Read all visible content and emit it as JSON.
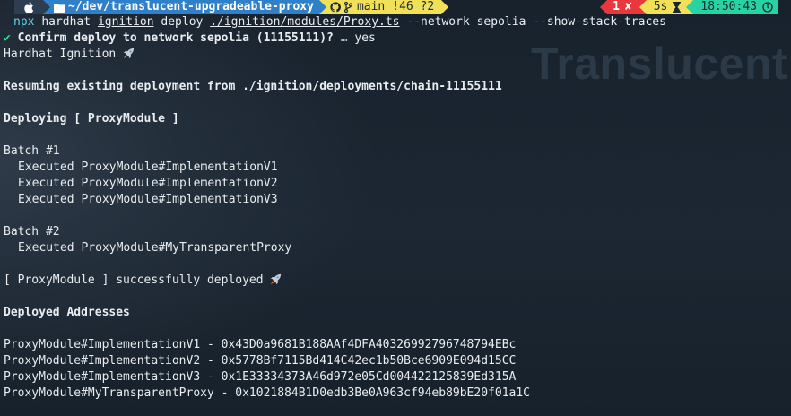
{
  "prompt": {
    "os_icon": "apple-icon",
    "folder_icon": "folder-icon",
    "path": "~/dev/translucent-upgradeable-proxy",
    "git_icon": "git-branch-icon",
    "branch": "main",
    "git_status": "!46 ?2",
    "exit_code": "1",
    "exit_mark": "✘",
    "duration": "5s",
    "duration_icon": "hourglass-icon",
    "time": "18:50:43",
    "clock_icon": "clock-icon",
    "colors": {
      "os": "#2c3e50",
      "dir": "#2f80c8",
      "git": "#f1e05a",
      "err": "#e8383d",
      "dur": "#f1e05a",
      "time": "#27d3a2"
    }
  },
  "command": {
    "npx": "npx",
    "hardhat": "hardhat",
    "ignition": "ignition",
    "deploy": "deploy",
    "file": "./ignition/modules/Proxy.ts",
    "args": "--network sepolia --show-stack-traces"
  },
  "confirm": {
    "check": "✔",
    "question": "Confirm deploy to network sepolia (11155111)?",
    "ellipsis": "…",
    "answer": "yes"
  },
  "output": {
    "ignition_title": "Hardhat Ignition",
    "resuming": "Resuming existing deployment from ./ignition/deployments/chain-11155111",
    "deploying": "Deploying [ ProxyModule ]",
    "batch1": "Batch #1",
    "batch1_items": [
      "Executed ProxyModule#ImplementationV1",
      "Executed ProxyModule#ImplementationV2",
      "Executed ProxyModule#ImplementationV3"
    ],
    "batch2": "Batch #2",
    "batch2_items": [
      "Executed ProxyModule#MyTransparentProxy"
    ],
    "success": "[ ProxyModule ] successfully deployed",
    "deployed_header": "Deployed Addresses",
    "addresses": [
      "ProxyModule#ImplementationV1 - 0x43D0a9681B188AAf4DFA40326992796748794EBc",
      "ProxyModule#ImplementationV2 - 0x5778Bf7115Bd414C42ec1b50Bce6909E094d15CC",
      "ProxyModule#ImplementationV3 - 0x1E33334373A46d972e05Cd004422125839Ed315A",
      "ProxyModule#MyTransparentProxy - 0x1021884B1D0edb3Be0A963cf94eb89bE20f01a1C"
    ]
  },
  "watermark": "Translucent"
}
